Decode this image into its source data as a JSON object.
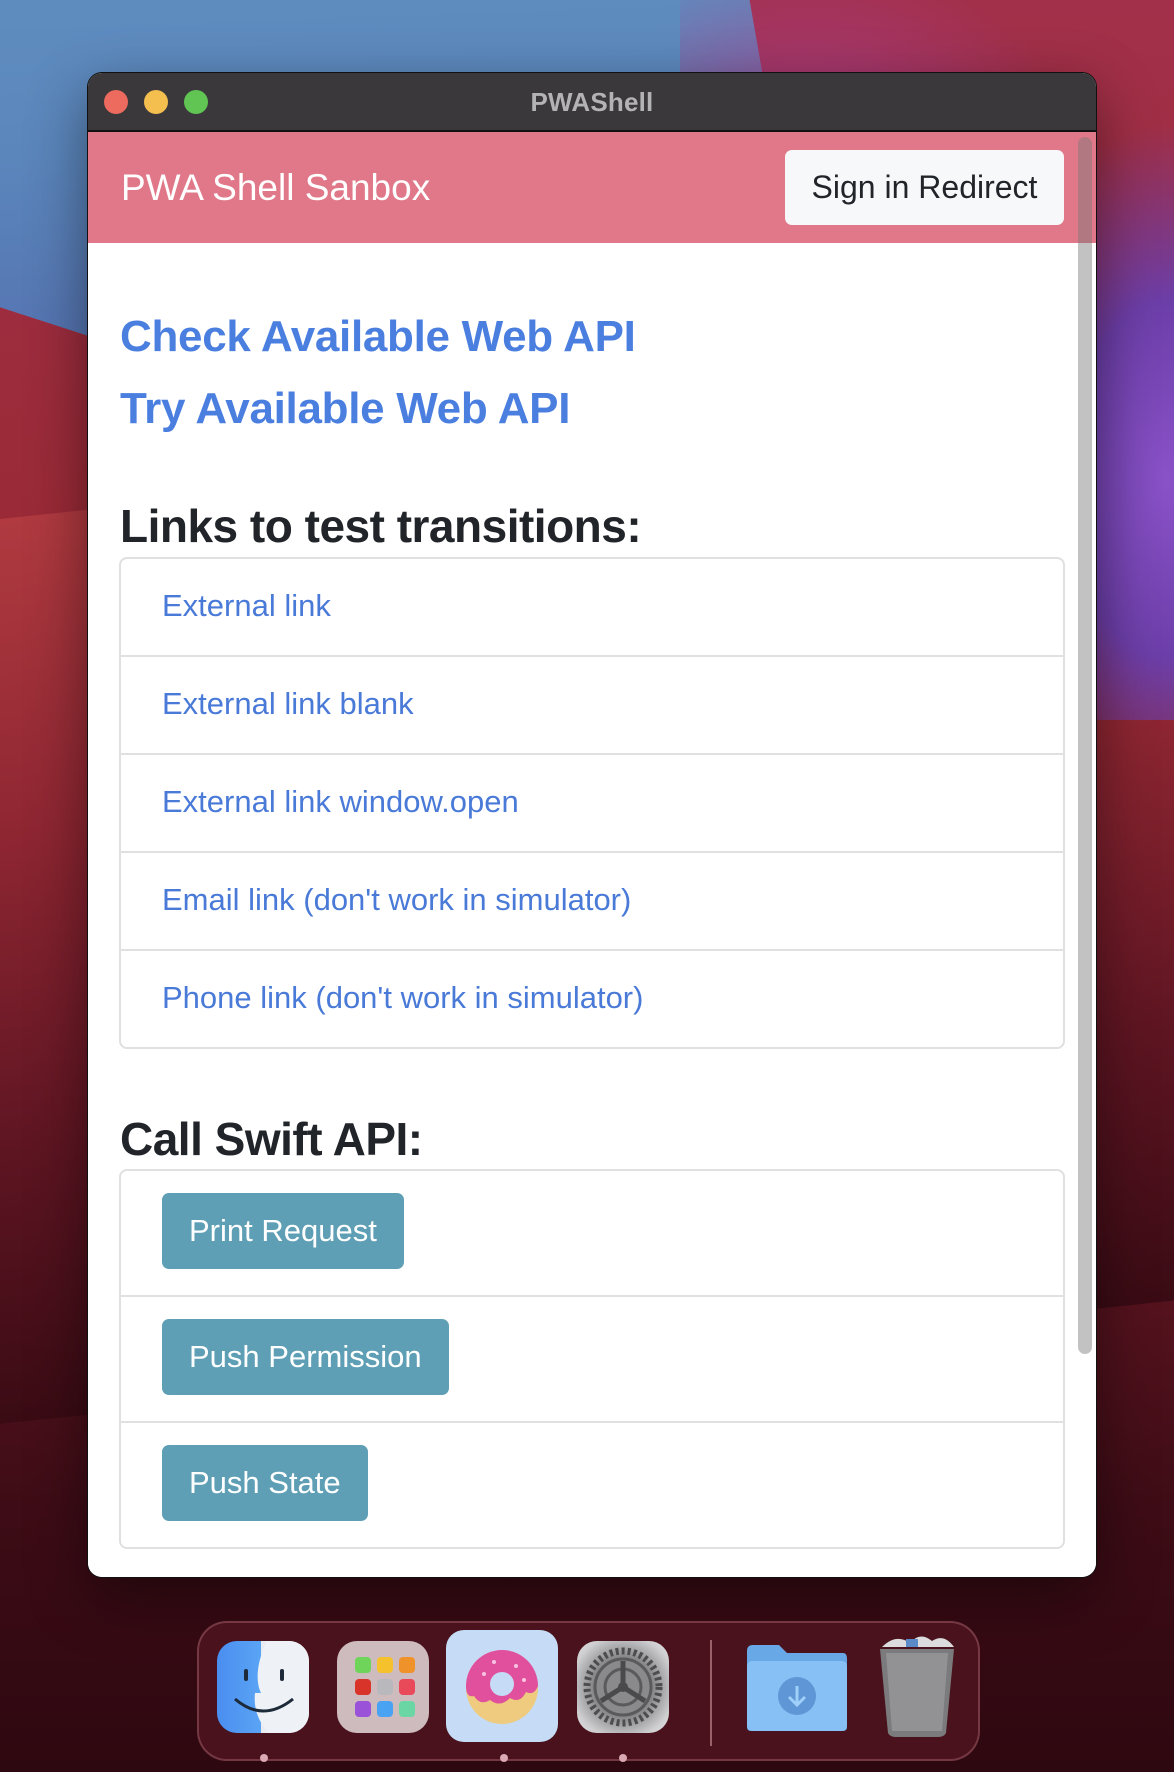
{
  "window": {
    "title": "PWAShell"
  },
  "navbar": {
    "brand": "PWA Shell Sanbox",
    "signin_label": "Sign in Redirect"
  },
  "main": {
    "api_links": [
      {
        "label": "Check Available Web API"
      },
      {
        "label": "Try Available Web API"
      }
    ],
    "transitions": {
      "heading": "Links to test transitions:",
      "links": [
        {
          "label": "External link"
        },
        {
          "label": "External link blank"
        },
        {
          "label": "External link window.open"
        },
        {
          "label": "Email link (don't work in simulator)"
        },
        {
          "label": "Phone link (don't work in simulator)"
        }
      ]
    },
    "swift_api": {
      "heading": "Call Swift API:",
      "buttons": [
        {
          "label": "Print Request"
        },
        {
          "label": "Push Permission"
        },
        {
          "label": "Push State"
        }
      ]
    }
  },
  "dock": {
    "items": [
      {
        "name": "Finder",
        "icon": "finder-icon",
        "running": true
      },
      {
        "name": "Launchpad",
        "icon": "launchpad-icon",
        "running": false
      },
      {
        "name": "PWAShell",
        "icon": "donut-icon",
        "running": true,
        "active": true
      },
      {
        "name": "System Preferences",
        "icon": "gear-icon",
        "running": true
      },
      {
        "name": "Downloads",
        "icon": "downloads-folder-icon",
        "running": false
      },
      {
        "name": "Trash",
        "icon": "trash-icon",
        "running": false
      }
    ]
  },
  "colors": {
    "navbar_bg": "#e07889",
    "link": "#4a7fe0",
    "info_button": "#5e9fb5",
    "titlebar": "#3a383b"
  }
}
